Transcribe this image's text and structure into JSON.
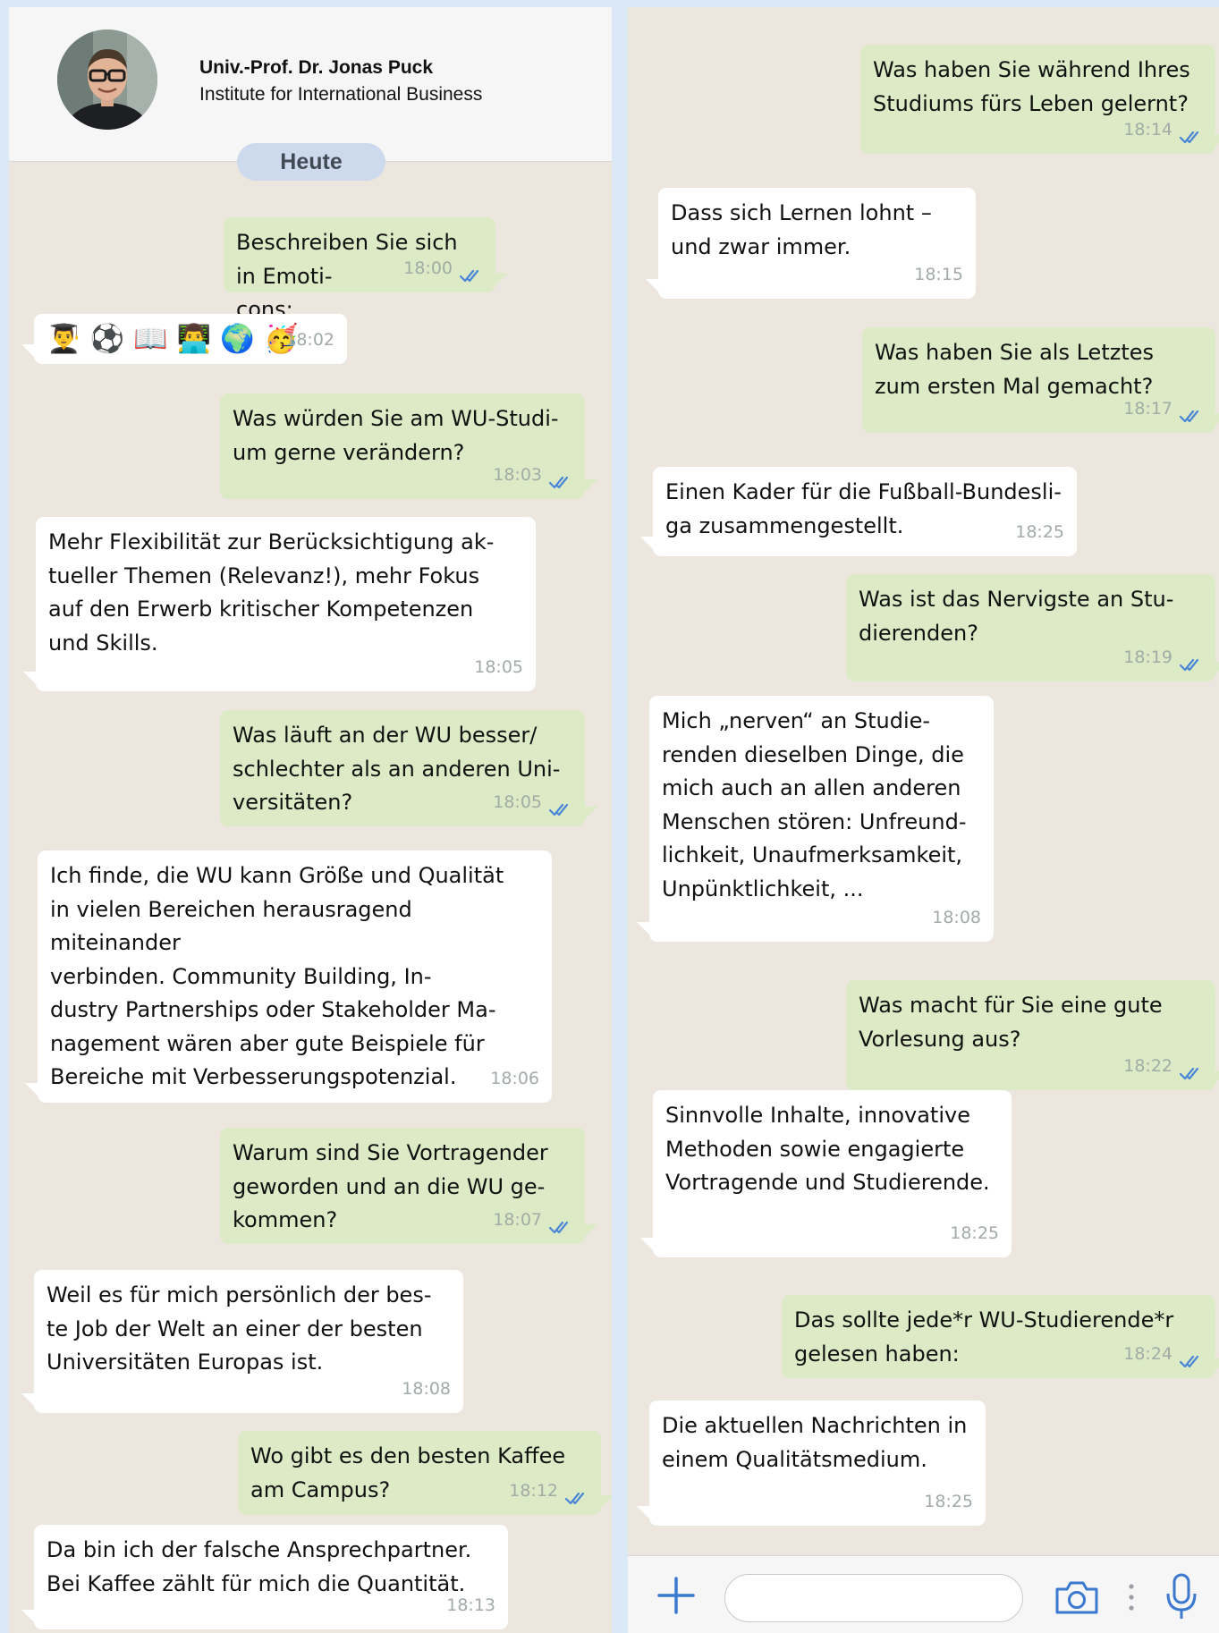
{
  "contact": {
    "name": "Univ.-Prof. Dr. Jonas Puck",
    "subtitle": "Institute for International Business"
  },
  "date_label": "Heute",
  "colors": {
    "outgoing_bubble": "#dcebc6",
    "incoming_bubble": "#ffffff",
    "chat_background": "#ece6df",
    "read_check": "#4a86d8",
    "accent_icons": "#3b78cf"
  },
  "messages_left": [
    {
      "dir": "out",
      "text": "Beschreiben Sie sich in Emoti-\ncons:",
      "time": "18:00",
      "read": true
    },
    {
      "dir": "in",
      "emoji": "👨‍🎓⚽📖👨‍💻🌍🥳",
      "time": "18:02"
    },
    {
      "dir": "out",
      "text": "Was würden Sie am WU-Studi-\num gerne verändern?",
      "time": "18:03",
      "read": true
    },
    {
      "dir": "in",
      "text": "Mehr Flexibilität zur Berücksichtigung ak-\ntueller Themen (Relevanz!), mehr Fokus\nauf den Erwerb kritischer Kompetenzen\nund Skills.",
      "time": "18:05"
    },
    {
      "dir": "out",
      "text": "Was läuft an der WU besser/\nschlechter als an anderen Uni-\nversitäten?",
      "time": "18:05",
      "read": true
    },
    {
      "dir": "in",
      "text": "Ich finde, die WU kann Größe und Qualität\nin vielen Bereichen herausragend miteinander\nverbinden. Community Building, In-\ndustry Partnerships oder Stakeholder Ma-\nnagement wären aber gute Beispiele für\nBereiche mit Verbesserungspotenzial.",
      "time": "18:06"
    },
    {
      "dir": "out",
      "text": "Warum sind Sie Vortragender\ngeworden und an die WU ge-\nkommen?",
      "time": "18:07",
      "read": true
    },
    {
      "dir": "in",
      "text": "Weil es für mich persönlich der bes-\nte Job der Welt an einer der besten\nUniversitäten Europas ist.",
      "time": "18:08"
    },
    {
      "dir": "out",
      "text": "Wo gibt es den besten Kaffee\nam Campus?",
      "time": "18:12",
      "read": true
    },
    {
      "dir": "in",
      "text": "Da bin ich der falsche Ansprechpartner.\nBei Kaffee zählt für mich die Quantität.",
      "time": "18:13"
    }
  ],
  "messages_right": [
    {
      "dir": "out",
      "text": "Was haben Sie während Ihres\nStudiums fürs Leben gelernt?",
      "time": "18:14",
      "read": true
    },
    {
      "dir": "in",
      "text": "Dass sich Lernen lohnt –\nund zwar immer.",
      "time": "18:15"
    },
    {
      "dir": "out",
      "text": "Was haben Sie als Letztes\nzum ersten Mal gemacht?",
      "time": "18:17",
      "read": true
    },
    {
      "dir": "in",
      "text": "Einen Kader für die Fußball-Bundesli-\nga zusammengestellt.",
      "time": "18:25"
    },
    {
      "dir": "out",
      "text": "Was ist das Nervigste an Stu-\ndierenden?",
      "time": "18:19",
      "read": true
    },
    {
      "dir": "in",
      "text": "Mich „nerven“ an Studie-\nrenden dieselben Dinge, die\nmich auch an allen anderen\nMenschen stören: Unfreund-\nlichkeit, Unaufmerksamkeit,\nUnpünktlichkeit, ...",
      "time": "18:08"
    },
    {
      "dir": "out",
      "text": "Was macht für Sie eine gute\nVorlesung aus?",
      "time": "18:22",
      "read": true
    },
    {
      "dir": "in",
      "text": "Sinnvolle Inhalte, innovative\nMethoden sowie engagierte\nVortragende und Studierende.",
      "time": "18:25"
    },
    {
      "dir": "out",
      "text": "Das sollte jede*r WU-Studierende*r\ngelesen haben:",
      "time": "18:24",
      "read": true
    },
    {
      "dir": "in",
      "text": "Die aktuellen Nachrichten in\neinem Qualitätsmedium.",
      "time": "18:25"
    }
  ],
  "composer": {
    "placeholder": "",
    "icons": [
      "plus-icon",
      "camera-icon",
      "more-dots-icon",
      "microphone-icon"
    ]
  }
}
